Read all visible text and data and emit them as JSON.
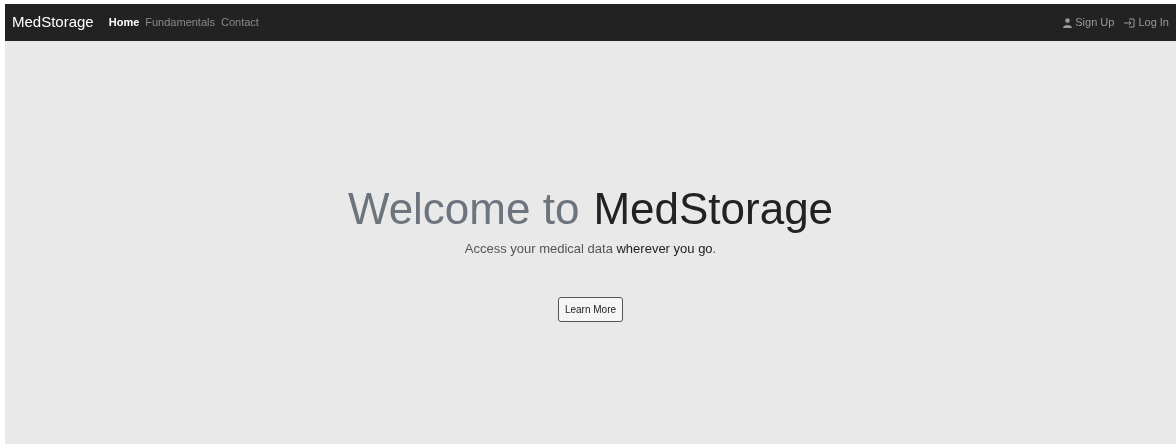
{
  "navbar": {
    "brand": "MedStorage",
    "links": [
      {
        "label": "Home",
        "selected": true
      },
      {
        "label": "Fundamentals",
        "selected": false
      },
      {
        "label": "Contact",
        "selected": false
      }
    ],
    "account_links": [
      {
        "label": "Sign Up",
        "kind": "person"
      },
      {
        "label": "Log In",
        "kind": "login"
      }
    ]
  },
  "hero": {
    "title_lead": "Welcome to",
    "title_name": "MedStorage",
    "subtitle": "Access your medical data **wherever you go**.",
    "button": "Learn More"
  }
}
